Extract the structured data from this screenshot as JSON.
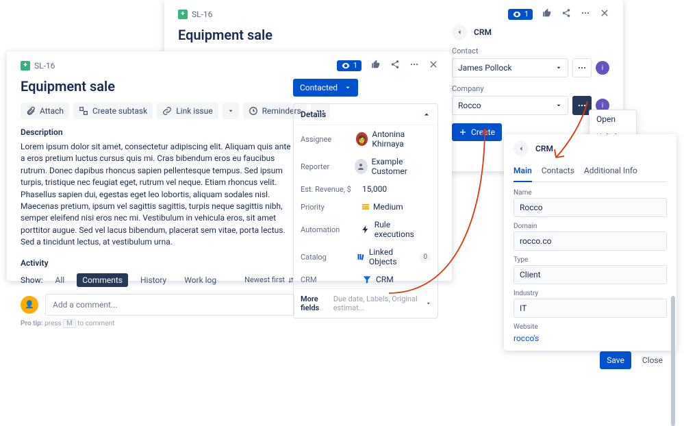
{
  "back": {
    "key": "SL-16",
    "title": "Equipment sale",
    "watch_count": "1"
  },
  "crm_side": {
    "title": "CRM",
    "contact_label": "Contact",
    "contact_value": "James Pollock",
    "company_label": "Company",
    "company_value": "Rocco",
    "create_label": "Create",
    "popover": {
      "open": "Open",
      "unlink": "Unlink"
    }
  },
  "front": {
    "key": "SL-16",
    "title": "Equipment sale",
    "watch_count": "1",
    "toolbar": {
      "attach": "Attach",
      "create_subtask": "Create subtask",
      "link_issue": "Link issue",
      "reminders": "Reminders"
    },
    "description_label": "Description",
    "description": "Lorem ipsum dolor sit amet, consectetur adipiscing elit. Aliquam quis ante a eros pretium luctus cursus quis mi. Cras bibendum eros eu faucibus rutrum. Donec dapibus rhoncus sapien pellentesque tempus. Sed ipsum turpis, tristique nec feugiat eget, rutrum vel neque. Etiam rhoncus velit. Phasellus sapien dui, egestas eget leo lobortis, aliquam sodales nisl. Maecenas pretium, ipsum vel sagittis sagittis, turpis neque sagittis nibh, semper eleifend nisi eros nec mi. Vestibulum in vehicula eros, sit amet porttitor augue. Sed vel lacus bibendum, placerat sem vitae, porta lectus. Sed a tincidunt lectus, at vestibulum urna.",
    "activity_label": "Activity",
    "show_label": "Show:",
    "tabs": {
      "all": "All",
      "comments": "Comments",
      "history": "History",
      "worklog": "Work log"
    },
    "newest_first": "Newest first",
    "comment_placeholder": "Add a comment...",
    "protip_prefix": "Pro tip:",
    "protip_text": "press",
    "protip_key": "M",
    "protip_suffix": "to comment",
    "status": "Contacted",
    "details_head": "Details",
    "fields": {
      "assignee": {
        "label": "Assignee",
        "value": "Antonina Khirnaya"
      },
      "reporter": {
        "label": "Reporter",
        "value": "Example Customer"
      },
      "revenue": {
        "label": "Est. Revenue, $",
        "value": "15,000"
      },
      "priority": {
        "label": "Priority",
        "value": "Medium"
      },
      "automation": {
        "label": "Automation",
        "value": "Rule executions"
      },
      "catalog": {
        "label": "Catalog",
        "value": "Linked Objects",
        "count": "0"
      },
      "crm": {
        "label": "CRM",
        "value": "CRM"
      }
    },
    "more_fields": "More fields",
    "more_fields_hint": "Due date, Labels, Original estimat..."
  },
  "crm_card": {
    "title": "CRM",
    "tabs": {
      "main": "Main",
      "contacts": "Contacts",
      "additional": "Additional Info"
    },
    "name": {
      "label": "Name",
      "value": "Rocco"
    },
    "domain": {
      "label": "Domain",
      "value": "rocco.co"
    },
    "type": {
      "label": "Type",
      "value": "Client"
    },
    "industry": {
      "label": "Industry",
      "value": "IT"
    },
    "website": {
      "label": "Website",
      "value": "rocco's"
    },
    "save": "Save",
    "close": "Close"
  }
}
